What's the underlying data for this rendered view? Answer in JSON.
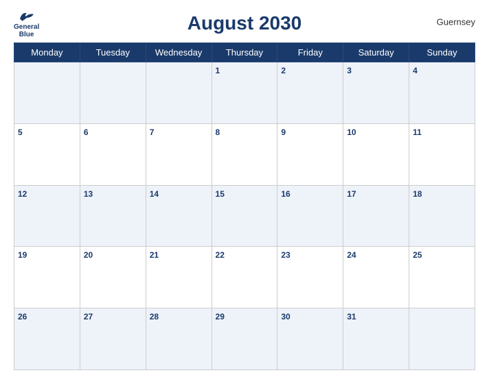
{
  "header": {
    "title": "August 2030",
    "country": "Guernsey",
    "logo": {
      "general": "General",
      "blue": "Blue"
    }
  },
  "calendar": {
    "weekdays": [
      "Monday",
      "Tuesday",
      "Wednesday",
      "Thursday",
      "Friday",
      "Saturday",
      "Sunday"
    ],
    "weeks": [
      [
        null,
        null,
        null,
        1,
        2,
        3,
        4
      ],
      [
        5,
        6,
        7,
        8,
        9,
        10,
        11
      ],
      [
        12,
        13,
        14,
        15,
        16,
        17,
        18
      ],
      [
        19,
        20,
        21,
        22,
        23,
        24,
        25
      ],
      [
        26,
        27,
        28,
        29,
        30,
        31,
        null
      ]
    ]
  }
}
